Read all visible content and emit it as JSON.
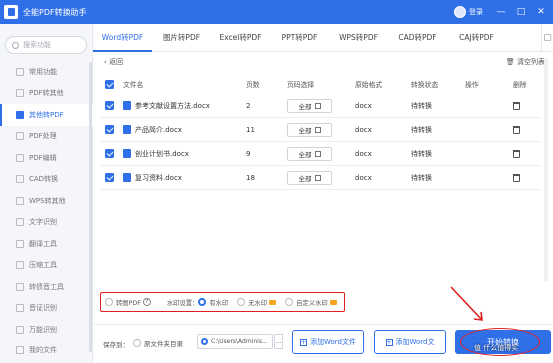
{
  "app": {
    "title": "全能PDF转换助手",
    "login": "登录"
  },
  "window_controls": [
    "—",
    "□",
    "✕"
  ],
  "search": {
    "placeholder": "搜索功能"
  },
  "sidebar": {
    "items": [
      {
        "label": "常用功能",
        "active": false
      },
      {
        "label": "PDF转其他",
        "active": false
      },
      {
        "label": "其他转PDF",
        "active": true
      },
      {
        "label": "PDF处理",
        "active": false
      },
      {
        "label": "PDF编辑",
        "active": false
      },
      {
        "label": "CAD转换",
        "active": false
      },
      {
        "label": "WPS转其他",
        "active": false
      },
      {
        "label": "文字识别",
        "active": false
      },
      {
        "label": "翻译工具",
        "active": false
      },
      {
        "label": "压缩工具",
        "active": false
      },
      {
        "label": "转债音工具",
        "active": false
      },
      {
        "label": "音证识别",
        "active": false
      },
      {
        "label": "万能识别",
        "active": false
      }
    ],
    "bottom": "我的文件"
  },
  "tabs": [
    {
      "label": "Word转PDF",
      "active": true
    },
    {
      "label": "图片转PDF",
      "active": false
    },
    {
      "label": "Excel转PDF",
      "active": false
    },
    {
      "label": "PPT转PDF",
      "active": false
    },
    {
      "label": "WPS转PDF",
      "active": false
    },
    {
      "label": "CAD转PDF",
      "active": false
    },
    {
      "label": "CAJ转PDF",
      "active": false
    }
  ],
  "toolbar": {
    "back": "返回",
    "clear": "清空列表"
  },
  "table": {
    "headers": {
      "name": "文件名",
      "pages": "页数",
      "range": "页码选择",
      "format": "原始格式",
      "status": "转换状态",
      "op": "操作",
      "del": "删除"
    },
    "rows": [
      {
        "name": "参考文献设置方法.docx",
        "pages": "2",
        "range": "全部",
        "format": "docx",
        "status": "待转换"
      },
      {
        "name": "产品简介.docx",
        "pages": "11",
        "range": "全部",
        "format": "docx",
        "status": "待转换"
      },
      {
        "name": "创业计划书.docx",
        "pages": "9",
        "range": "全部",
        "format": "docx",
        "status": "待转换"
      },
      {
        "name": "复习资料.docx",
        "pages": "18",
        "range": "全部",
        "format": "docx",
        "status": "待转换"
      }
    ]
  },
  "options": {
    "image_pdf": "转图PDF",
    "watermark_label": "水印设置：",
    "watermark_on": "有水印",
    "watermark_off": "无水印",
    "watermark_custom": "自定义水印"
  },
  "bottom": {
    "save_to": "保存到：",
    "source_dir": "原文件夹目录",
    "path": "C:\\Users\\Adminis...",
    "path_more": "...",
    "add_file": "添加Word文件",
    "add_folder": "添加Word文",
    "start": "开始转换"
  },
  "watermark_text": "值 什么值得买",
  "colors": {
    "accent": "#2f6fe8",
    "highlight": "#e02020",
    "vip": "#f4a623"
  }
}
